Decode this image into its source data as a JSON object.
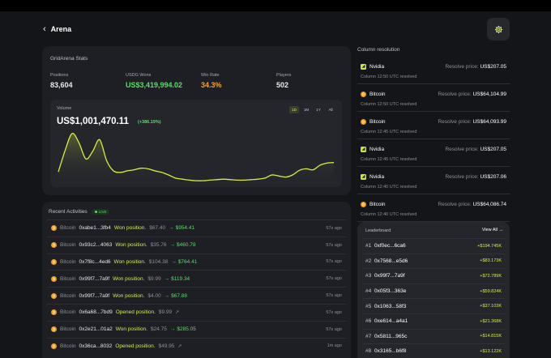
{
  "header": {
    "back_icon": "chevron-left-icon",
    "title": "Arena",
    "settings_icon": "gear-icon"
  },
  "stats": {
    "title": "GridArena Stats",
    "items": [
      {
        "label": "Positions",
        "value": "83,604"
      },
      {
        "label": "USDG Wons",
        "value": "US$3,419,994.02"
      },
      {
        "label": "Win Rate",
        "value": "34.3%"
      },
      {
        "label": "Players",
        "value": "502"
      }
    ]
  },
  "volume": {
    "label": "Volume",
    "value": "US$1,001,470.11",
    "change": "(+386.19%)",
    "ranges": [
      "1D",
      "1M",
      "1Y",
      "All"
    ],
    "active_range": "1D"
  },
  "chart_data": {
    "type": "area",
    "title": "",
    "xlabel": "",
    "ylabel": "",
    "x": [
      0,
      1,
      2,
      3,
      4,
      5,
      6,
      7,
      8,
      9,
      10,
      11,
      12,
      13,
      14,
      15,
      16,
      17,
      18,
      19,
      20,
      21,
      22,
      23,
      24,
      25,
      26,
      27,
      28,
      29,
      30,
      31,
      32,
      33,
      34,
      35,
      36,
      37,
      38,
      39,
      40
    ],
    "series": [
      {
        "values": [
          20,
          62,
          94,
          76,
          45,
          60,
          82,
          42,
          22,
          19,
          22,
          24,
          27,
          26,
          22,
          19,
          14,
          8,
          6,
          4,
          3,
          3,
          4,
          5,
          6,
          5,
          4,
          4,
          5,
          6,
          8,
          14,
          12,
          10,
          14,
          23,
          26,
          24,
          33,
          37,
          38
        ]
      }
    ],
    "ylim": [
      0,
      100
    ],
    "colors": {
      "line": "#d9ee3f",
      "fill_top": "#9aa83a",
      "fill_bottom": "#24262c"
    }
  },
  "activities": {
    "title": "Recent Activities",
    "live_label": "LIVE",
    "rows": [
      {
        "asset": "Bitcoin",
        "addr": "0xabe1...3fb4",
        "action": "Won position.",
        "amount": "$67.40",
        "arrow": "→",
        "value": "$954.41",
        "time": "57s ago"
      },
      {
        "asset": "Bitcoin",
        "addr": "0x93c2...4063",
        "action": "Won position.",
        "amount": "$35.76",
        "arrow": "→",
        "value": "$460.78",
        "time": "57s ago"
      },
      {
        "asset": "Bitcoin",
        "addr": "0x7f8c...4ed6",
        "action": "Won position.",
        "amount": "$104.38",
        "arrow": "→",
        "value": "$764.41",
        "time": "57s ago"
      },
      {
        "asset": "Bitcoin",
        "addr": "0x99f7...7a9f",
        "action": "Won position.",
        "amount": "$9.99",
        "arrow": "→",
        "value": "$119.34",
        "time": "57s ago"
      },
      {
        "asset": "Bitcoin",
        "addr": "0x99f7...7a9f",
        "action": "Won position.",
        "amount": "$4.00",
        "arrow": "→",
        "value": "$67.88",
        "time": "57s ago"
      },
      {
        "asset": "Bitcoin",
        "addr": "0x6a68...7bd9",
        "action": "Opened position.",
        "amount": "$9.99",
        "arrow": "",
        "value": "",
        "time": "57s ago"
      },
      {
        "asset": "Bitcoin",
        "addr": "0x2e21...01a2",
        "action": "Won position.",
        "amount": "$24.75",
        "arrow": "→",
        "value": "$285.05",
        "time": "57s ago"
      },
      {
        "asset": "Bitcoin",
        "addr": "0x36ca...8032",
        "action": "Opened position.",
        "amount": "$49.95",
        "arrow": "",
        "value": "",
        "time": "1m ago"
      }
    ]
  },
  "resolution": {
    "title": "Column resolution",
    "rows": [
      {
        "asset": "Nvidia",
        "kind": "nvidia",
        "sub": "Column 12:50 UTC resolved",
        "price_label": "Resolve price:",
        "price": "US$207.05"
      },
      {
        "asset": "Bitcoin",
        "kind": "bitcoin",
        "sub": "Column 12:50 UTC resolved",
        "price_label": "Resolve price:",
        "price": "US$64,104.99"
      },
      {
        "asset": "Bitcoin",
        "kind": "bitcoin",
        "sub": "Column 12:45 UTC resolved",
        "price_label": "Resolve price:",
        "price": "US$64,093.99"
      },
      {
        "asset": "Nvidia",
        "kind": "nvidia",
        "sub": "Column 12:45 UTC resolved",
        "price_label": "Resolve price:",
        "price": "US$207.05"
      },
      {
        "asset": "Nvidia",
        "kind": "nvidia",
        "sub": "Column 12:40 UTC resolved",
        "price_label": "Resolve price:",
        "price": "US$207.06"
      },
      {
        "asset": "Bitcoin",
        "kind": "bitcoin",
        "sub": "Column 12:40 UTC resolved",
        "price_label": "Resolve price:",
        "price": "US$64,086.74"
      }
    ]
  },
  "leaderboard": {
    "title": "Leaderboard",
    "view_all": "View All →",
    "rows": [
      {
        "rank": "#1",
        "addr": "0xf0ec...6ca6",
        "amount": "+$194.745K"
      },
      {
        "rank": "#2",
        "addr": "0x7568...e5d6",
        "amount": "+$83.173K"
      },
      {
        "rank": "#3",
        "addr": "0x99f7...7a9f",
        "amount": "+$72.789K"
      },
      {
        "rank": "#4",
        "addr": "0x05f3...363e",
        "amount": "+$59.824K"
      },
      {
        "rank": "#5",
        "addr": "0x1063...58f3",
        "amount": "+$37.103K"
      },
      {
        "rank": "#6",
        "addr": "0xe614...a4a1",
        "amount": "+$21.368K"
      },
      {
        "rank": "#7",
        "addr": "0x5811...965c",
        "amount": "+$14.815K"
      },
      {
        "rank": "#8",
        "addr": "0x3165...b6f8",
        "amount": "+$13.122K"
      }
    ]
  }
}
